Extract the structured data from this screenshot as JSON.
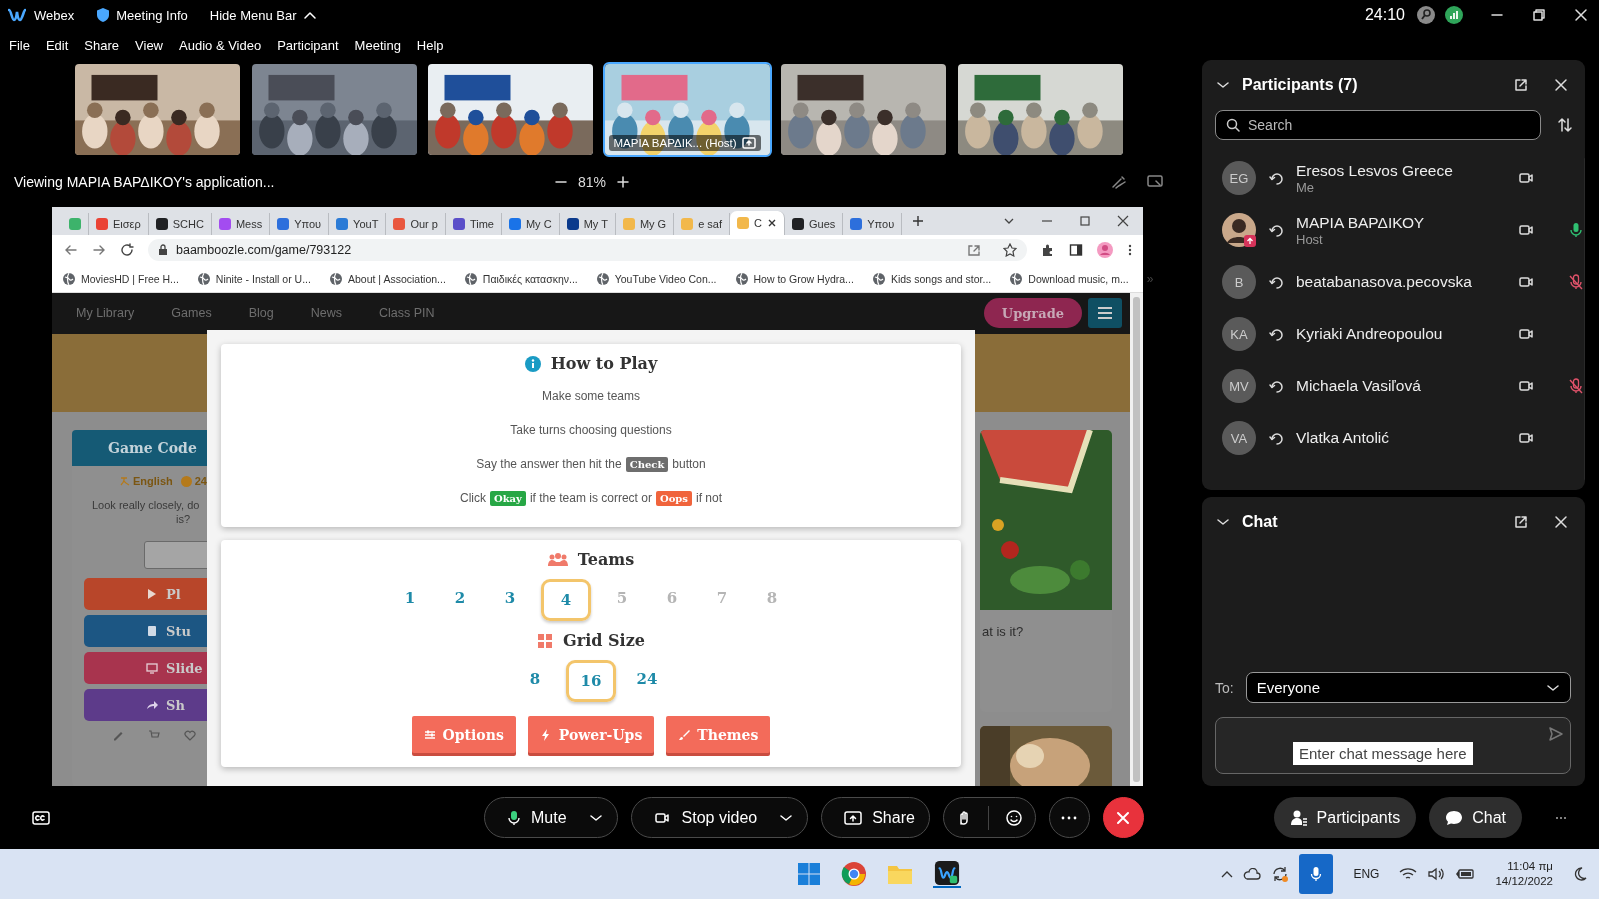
{
  "app_bar": {
    "app_name": "Webex",
    "meeting_info": "Meeting Info",
    "hide_menu": "Hide Menu Bar",
    "timer": "24:10"
  },
  "menu": [
    "File",
    "Edit",
    "Share",
    "View",
    "Audio & Video",
    "Participant",
    "Meeting",
    "Help"
  ],
  "videos": [
    {
      "kind": "picture",
      "selected": false
    },
    {
      "kind": "picture",
      "selected": false
    },
    {
      "kind": "picture",
      "selected": false
    },
    {
      "kind": "picture",
      "selected": true,
      "label": "ΜΑΡΙΑ ΒΑΡΔΙΚ... (Host)"
    },
    {
      "kind": "picture",
      "selected": false
    },
    {
      "kind": "picture",
      "selected": false
    }
  ],
  "share_bar": {
    "viewing": "Viewing ΜΑΡΙΑ ΒΑΡΔΙΚΟΥ's application...",
    "zoom": "81%"
  },
  "browser": {
    "tabs": [
      {
        "color": "#3db36b",
        "selected": false
      },
      {
        "label": "Εισερ",
        "color": "#ea4335",
        "selected": false
      },
      {
        "label": "SCHC",
        "color": "#202124",
        "selected": false
      },
      {
        "label": "Mess",
        "color": "#a34cf0",
        "selected": false
      },
      {
        "label": "Υπου",
        "color": "#2d6fdc",
        "selected": false
      },
      {
        "label": "YouT",
        "color": "#2b7bd6",
        "selected": false
      },
      {
        "label": "Our p",
        "color": "#e9573f",
        "selected": false
      },
      {
        "label": "Time",
        "color": "#5b4fc9",
        "selected": false
      },
      {
        "label": "My C",
        "color": "#1a73e8",
        "selected": false
      },
      {
        "label": "My T",
        "color": "#0b3a8c",
        "selected": false
      },
      {
        "label": "My G",
        "color": "#f2b84b",
        "selected": false
      },
      {
        "label": "e saf",
        "color": "#f2b84b",
        "selected": false
      },
      {
        "label": "C",
        "color": "#f2b84b",
        "selected": true
      },
      {
        "label": "Gues",
        "color": "#202124",
        "selected": false
      },
      {
        "label": "Υπου",
        "color": "#2d6fdc",
        "selected": false
      }
    ],
    "url": "baamboozle.com/game/793122",
    "bookmarks": [
      "MoviesHD | Free H...",
      "Ninite - Install or U...",
      "About | Association...",
      "Παιδικές κατασκην...",
      "YouTube Video Con...",
      "How to Grow Hydra...",
      "Kids songs and stor...",
      "Download music, m..."
    ],
    "bookmarks_more": "»"
  },
  "site": {
    "nav": [
      "My Library",
      "Games",
      "Blog",
      "News",
      "Class PIN"
    ],
    "upgrade": "Upgrade",
    "game_card": {
      "title": "Game Code",
      "language": "English",
      "count": "24",
      "prompt": "Look really closely, do",
      "prompt_end": "is?",
      "buttons": [
        {
          "kind": "play",
          "label": "Pl"
        },
        {
          "kind": "study",
          "label": "Stu"
        },
        {
          "kind": "slides",
          "label": "Slide"
        },
        {
          "kind": "share",
          "label": "Sh"
        }
      ]
    },
    "question_card": {
      "text": "at is it?"
    }
  },
  "modal": {
    "how_title": "How to Play",
    "steps": [
      [
        {
          "text": "Make some teams"
        }
      ],
      [
        {
          "text": "Take turns choosing questions"
        }
      ],
      [
        {
          "text": "Say the answer then hit the"
        },
        {
          "kind": "check",
          "badge": "Check"
        },
        {
          "text": "button"
        }
      ],
      [
        {
          "text": "Click"
        },
        {
          "kind": "okay",
          "badge": "Okay"
        },
        {
          "text": "if the team is correct or"
        },
        {
          "kind": "oops",
          "badge": "Oops"
        },
        {
          "text": "if not"
        }
      ]
    ],
    "teams_title": "Teams",
    "teams": [
      {
        "label": "1",
        "selected": false,
        "disabled": false
      },
      {
        "label": "2",
        "selected": false,
        "disabled": false
      },
      {
        "label": "3",
        "selected": false,
        "disabled": false
      },
      {
        "label": "4",
        "selected": true,
        "disabled": false
      },
      {
        "label": "5",
        "selected": false,
        "disabled": true
      },
      {
        "label": "6",
        "selected": false,
        "disabled": true
      },
      {
        "label": "7",
        "selected": false,
        "disabled": true
      },
      {
        "label": "8",
        "selected": false,
        "disabled": true
      }
    ],
    "grid_title": "Grid Size",
    "grid": [
      {
        "label": "8",
        "selected": false
      },
      {
        "label": "16",
        "selected": true
      },
      {
        "label": "24",
        "selected": false
      }
    ],
    "buttons": [
      {
        "kind": "options",
        "label": "Options"
      },
      {
        "kind": "powerups",
        "label": "Power-Ups"
      },
      {
        "kind": "themes",
        "label": "Themes"
      }
    ]
  },
  "participants": {
    "title": "Participants (7)",
    "search_placeholder": "Search",
    "people": [
      {
        "kind": "initials",
        "initials": "EG",
        "name": "Eresos Lesvos Greece",
        "role": "Me",
        "mic_on": false,
        "muted": false
      },
      {
        "name": "ΜΑΡΙΑ ΒΑΡΔΙΚΟΥ",
        "role": "Host",
        "mic_on": true,
        "muted": false
      },
      {
        "kind": "initials",
        "initials": "B",
        "name": "beatabanasova.pecovska",
        "mic_on": false,
        "muted": true
      },
      {
        "kind": "initials",
        "initials": "KA",
        "name": "Kyriaki Andreopoulou",
        "mic_on": false,
        "muted": false
      },
      {
        "kind": "initials",
        "initials": "MV",
        "name": "Michaela Vasiľová",
        "mic_on": false,
        "muted": true
      },
      {
        "kind": "initials",
        "initials": "VA",
        "name": "Vlatka Antolić",
        "mic_on": false,
        "muted": false
      }
    ]
  },
  "chat": {
    "title": "Chat",
    "to_label": "To:",
    "recipient": "Everyone",
    "tooltip": "Enter chat message here"
  },
  "controls": {
    "mute": "Mute",
    "video": "Stop video",
    "share": "Share",
    "participants": "Participants",
    "chat": "Chat"
  },
  "taskbar": {
    "language": "ENG",
    "time": "11:04 πμ",
    "date": "14/12/2022"
  }
}
